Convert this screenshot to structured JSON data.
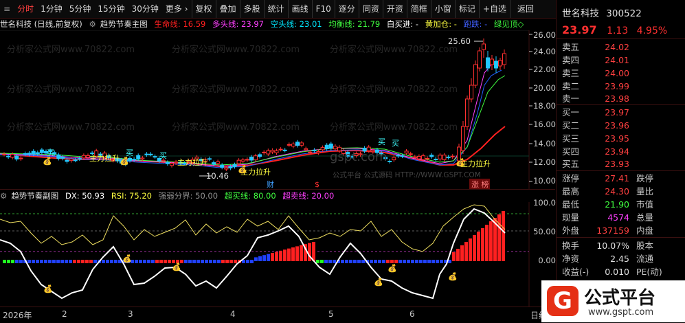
{
  "toolbar": {
    "items": [
      "分时",
      "1分钟",
      "5分钟",
      "15分钟",
      "30分钟",
      "更多 ›",
      "复权",
      "叠加",
      "多股",
      "统计",
      "画线",
      "F10",
      "逐分",
      "同资",
      "开资",
      "简框",
      "小窗",
      "标记",
      "+自选",
      "返回"
    ]
  },
  "main": {
    "title": "世名科技 (日线,前复权)",
    "indicator": "趋势节奏主图",
    "life_line": "生命线: 16.59",
    "bull_line": "多头线: 23.97",
    "bear_line": "空头线: 23.01",
    "balance_line": "均衡线: 21.79",
    "buy_sell": "白买进: -",
    "gold_combo": "黄加仓: -",
    "fall": "跑跌: -",
    "top": "绿见顶◇",
    "y_ticks": [
      "26.00",
      "24.00",
      "22.00",
      "20.00",
      "18.00",
      "16.00",
      "14.00",
      "12.00",
      "10.00"
    ],
    "high_label": "25.60",
    "low_label": "10.46",
    "annotations": [
      "主力拉升",
      "主力拉升",
      "主力拉升",
      "主力拉升"
    ],
    "buy_marks": [
      "买",
      "买",
      "买",
      "买",
      "买"
    ],
    "event_cai": "财",
    "event_s": "$",
    "event_zt": "涨 榜",
    "watermark_url": "分析家公式网www.70822.com",
    "watermark2": "公式平台 公式源码 HTTP://WWW.GSPT.COM",
    "gspt": "gspt.com"
  },
  "sub": {
    "indicator": "趋势节奏副图",
    "dx": "DX: 50.93",
    "rsi": "RSI: 75.20",
    "split": "强弱分界: 50.00",
    "overbuy": "超买线: 80.00",
    "oversell": "超卖线: 20.00",
    "y_ticks": [
      "100.0",
      "50.00",
      "0.00"
    ]
  },
  "dates": [
    "2026年",
    "2",
    "3",
    "4",
    "5",
    "6",
    "日线"
  ],
  "quote": {
    "name": "世名科技",
    "code": "300522",
    "price": "23.97",
    "change": "1.13",
    "pct": "4.95%",
    "asks": [
      [
        "卖五",
        "24.02"
      ],
      [
        "卖四",
        "24.01"
      ],
      [
        "卖三",
        "24.00"
      ],
      [
        "卖二",
        "23.99"
      ],
      [
        "卖一",
        "23.98"
      ]
    ],
    "bids": [
      [
        "买一",
        "23.97"
      ],
      [
        "买二",
        "23.96"
      ],
      [
        "买三",
        "23.95"
      ],
      [
        "买四",
        "23.94"
      ],
      [
        "买五",
        "23.93"
      ]
    ],
    "stats": [
      [
        "涨停",
        "27.41",
        "跌停"
      ],
      [
        "最高",
        "24.30",
        "量比"
      ],
      [
        "最低",
        "21.90",
        "市值"
      ],
      [
        "现量",
        "4574",
        "总量"
      ],
      [
        "外盘",
        "137159",
        "内盘"
      ]
    ],
    "stats2": [
      [
        "换手",
        "10.07%",
        "股本"
      ],
      [
        "净资",
        "2.45",
        "流通"
      ],
      [
        "收益(-)",
        "0.010",
        "PE(动)"
      ]
    ]
  },
  "logo": {
    "text": "公式平台",
    "url": "www.gspt.com"
  },
  "colors": {
    "up": "#ff3030",
    "down": "#22c8ff",
    "bull": "#ff40ff",
    "bear": "#00e8ff",
    "balance": "#40ff40",
    "life": "#ff2020"
  }
}
